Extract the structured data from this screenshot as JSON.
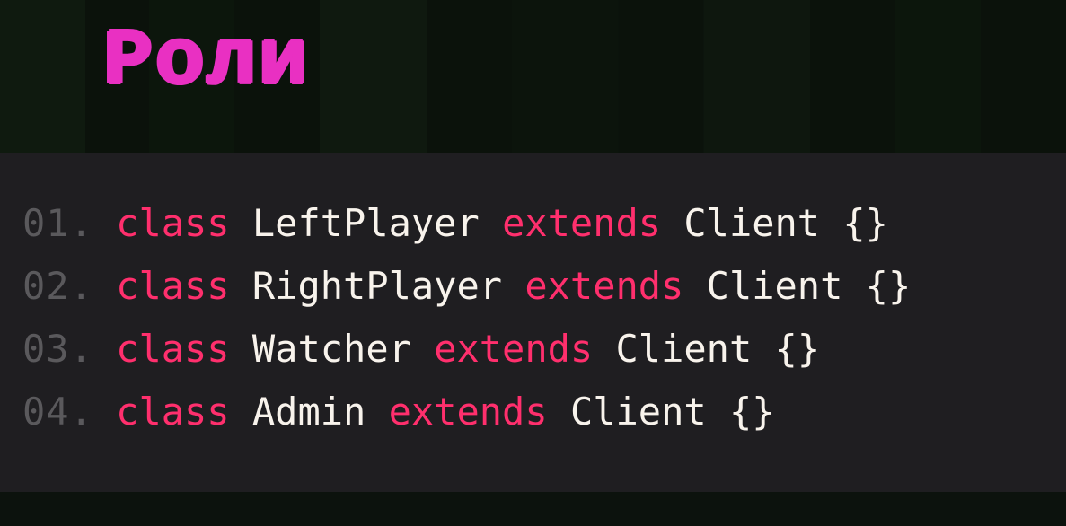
{
  "title": "Роли",
  "code": {
    "keyword_class": "class",
    "keyword_extends": "extends",
    "base_class": "Client",
    "braces": "{}",
    "lines": [
      {
        "num": "01.",
        "name": "LeftPlayer"
      },
      {
        "num": "02.",
        "name": "RightPlayer"
      },
      {
        "num": "03.",
        "name": "Watcher"
      },
      {
        "num": "04.",
        "name": "Admin"
      }
    ]
  }
}
